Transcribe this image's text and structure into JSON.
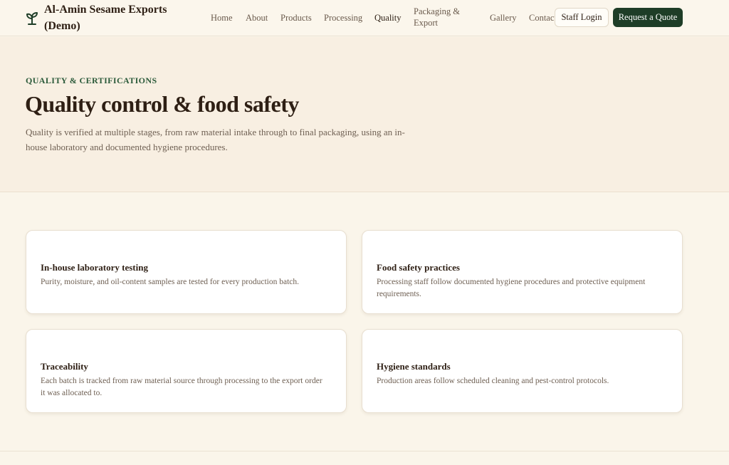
{
  "brand": {
    "name": "Al-Amin Sesame Exports (Demo)",
    "icon": "sprout-icon"
  },
  "nav": {
    "home": "Home",
    "about": "About",
    "products": "Products",
    "processing": "Processing",
    "quality": "Quality",
    "packaging": "Packaging & Export",
    "gallery": "Gallery",
    "contact": "Contact"
  },
  "actions": {
    "staff_login": "Staff Login",
    "request_quote": "Request a Quote"
  },
  "hero": {
    "eyebrow": "QUALITY & CERTIFICATIONS",
    "title": "Quality control & food safety",
    "description": "Quality is verified at multiple stages, from raw material intake through to final packaging, using an in-house laboratory and documented hygiene procedures."
  },
  "cards": [
    {
      "title": "In-house laboratory testing",
      "body": "Purity, moisture, and oil-content samples are tested for every production batch."
    },
    {
      "title": "Food safety practices",
      "body": "Processing staff follow documented hygiene procedures and protective equipment requirements."
    },
    {
      "title": "Traceability",
      "body": "Each batch is tracked from raw material source through processing to the export order it was allocated to."
    },
    {
      "title": "Hygiene standards",
      "body": "Production areas follow scheduled cleaning and pest-control protocols."
    }
  ],
  "colors": {
    "accent": "#1e3d27",
    "eyebrow": "#2b5a3a",
    "background": "#faf5ea",
    "hero_background": "#f8efe2"
  }
}
